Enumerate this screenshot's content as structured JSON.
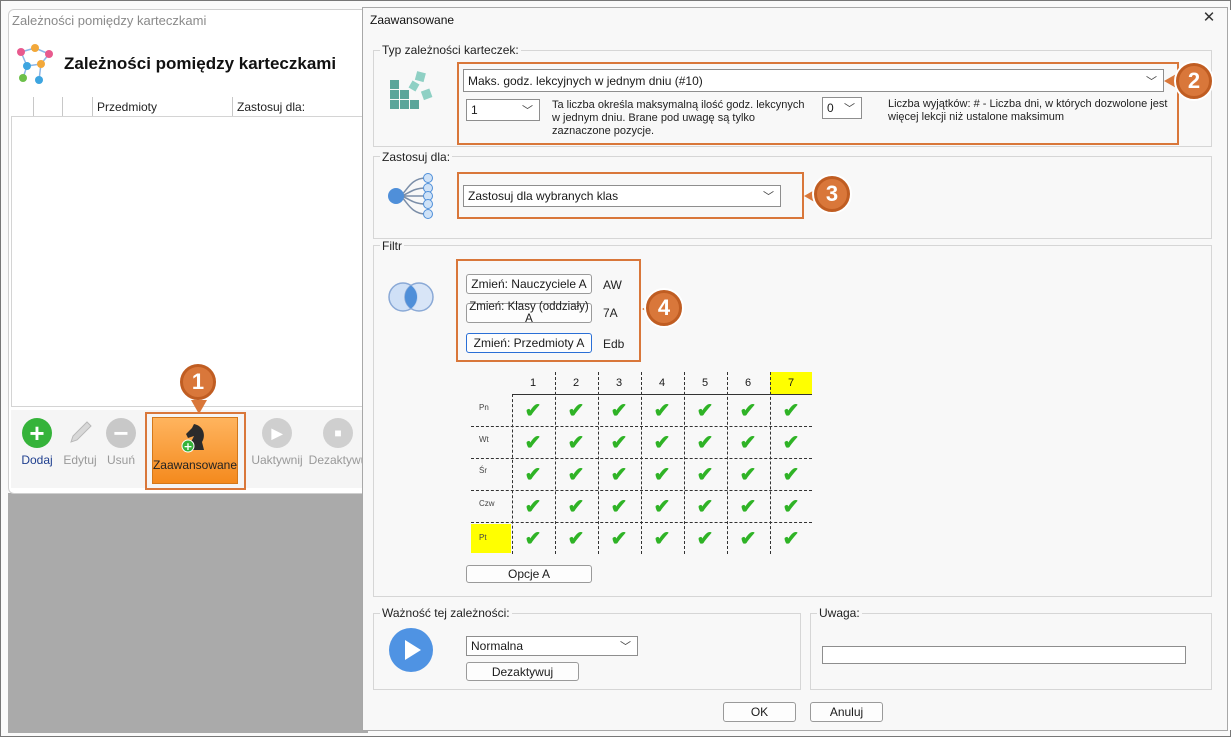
{
  "main_window": {
    "title": "Zależności pomiędzy karteczkami",
    "heading": "Zależności pomiędzy karteczkami",
    "columns": [
      "",
      "",
      "Przedmioty",
      "Zastosuj dla:"
    ],
    "toolbar": {
      "add": "Dodaj",
      "edit": "Edytuj",
      "remove": "Usuń",
      "advanced": "Zaawansowane",
      "activate": "Uaktywnij",
      "deactivate": "Dezaktywu"
    }
  },
  "dialog": {
    "title": "Zaawansowane",
    "close": "✕",
    "type_group": {
      "label": "Typ zależności karteczek:",
      "type_value": "Maks. godz. lekcyjnych w jednym dniu (#10)",
      "count_value": "1",
      "count_desc": "Ta liczba określa maksymalną ilość godz. lekcynych w jednym dniu. Brane pod uwagę są tylko zaznaczone pozycje.",
      "exceptions_value": "0",
      "exceptions_desc": "Liczba wyjątków: # - Liczba dni, w których dozwolone jest więcej lekcji niż ustalone maksimum"
    },
    "apply_group": {
      "label": "Zastosuj dla:",
      "value": "Zastosuj dla wybranych klas"
    },
    "filter_group": {
      "label": "Filtr",
      "teachers_btn": "Zmień: Nauczyciele A",
      "teachers_val": "AW",
      "classes_btn": "Zmień: Klasy (oddziały) A",
      "classes_val": "7A",
      "subjects_btn": "Zmień: Przedmioty A",
      "subjects_val": "Edb",
      "options_btn": "Opcje A"
    },
    "grid": {
      "periods": [
        "1",
        "2",
        "3",
        "4",
        "5",
        "6",
        "7"
      ],
      "days": [
        "Pn",
        "Wt",
        "Śr",
        "Czw",
        "Pt"
      ],
      "highlight_color": "#ffff00",
      "check_color": "#2fb326"
    },
    "importance_group": {
      "label": "Ważność tej zależności:",
      "value": "Normalna",
      "deactivate_btn": "Dezaktywuj"
    },
    "note_group": {
      "label": "Uwaga:"
    },
    "ok": "OK",
    "cancel": "Anuluj"
  },
  "callouts": {
    "one": "1",
    "two": "2",
    "three": "3",
    "four": "4",
    "color": "#d9773a"
  }
}
